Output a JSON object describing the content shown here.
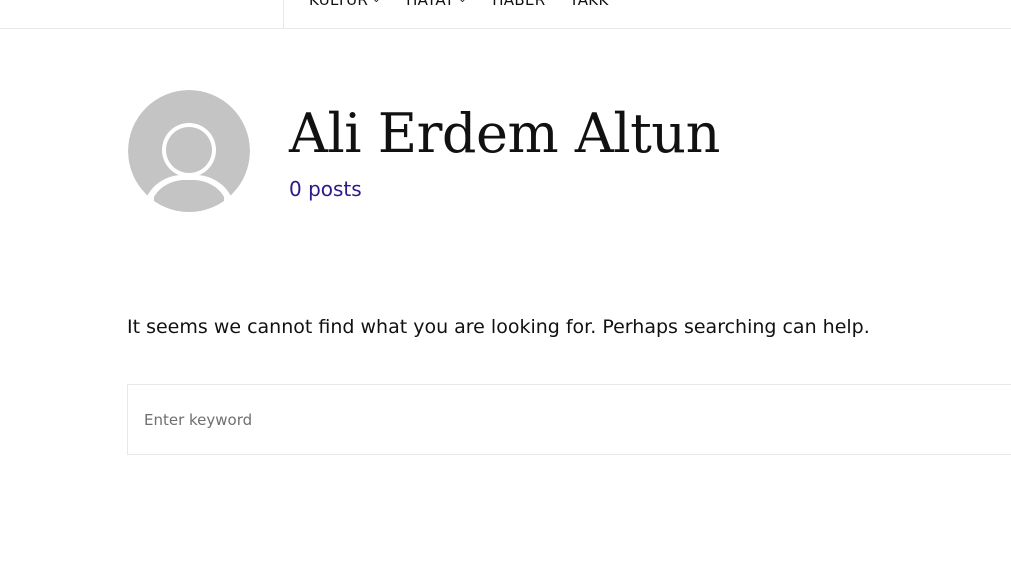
{
  "nav": {
    "items": [
      {
        "label": "KÜLTÜR",
        "has_dropdown": true
      },
      {
        "label": "HAYAT",
        "has_dropdown": true
      },
      {
        "label": "HABER",
        "has_dropdown": false
      },
      {
        "label": "YAKK",
        "has_dropdown": false
      }
    ]
  },
  "author": {
    "name": "Ali Erdem Altun",
    "posts_label": "0 posts",
    "avatar_icon": "default-avatar-icon"
  },
  "notice": {
    "text": "It seems we cannot find what you are looking for. Perhaps searching can help."
  },
  "search": {
    "placeholder": "Enter keyword",
    "value": ""
  },
  "colors": {
    "accent": "#2b1a8a",
    "avatar_bg": "#c4c4c4",
    "border": "#e8e8e8"
  }
}
